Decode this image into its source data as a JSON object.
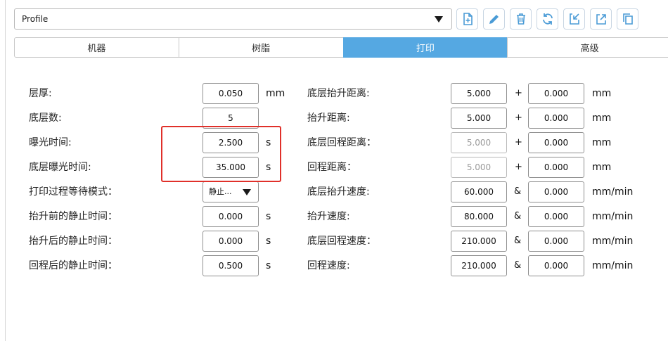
{
  "profile": {
    "value": "Profile"
  },
  "toolbar": {
    "icons": [
      "new-file-icon",
      "pencil-icon",
      "trash-icon",
      "refresh-icon",
      "import-icon",
      "export-icon",
      "copy-icon"
    ]
  },
  "tabs": [
    {
      "label": "机器",
      "active": false
    },
    {
      "label": "树脂",
      "active": false
    },
    {
      "label": "打印",
      "active": true
    },
    {
      "label": "高级",
      "active": false
    }
  ],
  "left": {
    "rows": [
      {
        "label": "层厚:",
        "value": "0.050",
        "unit": "mm"
      },
      {
        "label": "底层数:",
        "value": "5",
        "unit": ""
      },
      {
        "label": "曝光时间:",
        "value": "2.500",
        "unit": "s"
      },
      {
        "label": "底层曝光时间:",
        "value": "35.000",
        "unit": "s"
      },
      {
        "label": "打印过程等待模式：",
        "value": "静止...",
        "unit": ""
      },
      {
        "label": "抬升前的静止时间：",
        "value": "0.000",
        "unit": "s"
      },
      {
        "label": "抬升后的静止时间：",
        "value": "0.000",
        "unit": "s"
      },
      {
        "label": "回程后的静止时间：",
        "value": "0.500",
        "unit": "s"
      }
    ]
  },
  "right": {
    "rows": [
      {
        "label": "底层抬升距离:",
        "value1": "5.000",
        "op": "+",
        "value2": "0.000",
        "unit": "mm"
      },
      {
        "label": "抬升距离:",
        "value1": "5.000",
        "op": "+",
        "value2": "0.000",
        "unit": "mm"
      },
      {
        "label": "底层回程距离：",
        "value1": "5.000",
        "op": "+",
        "value2": "0.000",
        "unit": "mm"
      },
      {
        "label": "回程距离：",
        "value1": "5.000",
        "op": "+",
        "value2": "0.000",
        "unit": "mm"
      },
      {
        "label": "底层抬升速度:",
        "value1": "60.000",
        "op": "&",
        "value2": "0.000",
        "unit": "mm/min"
      },
      {
        "label": "抬升速度:",
        "value1": "80.000",
        "op": "&",
        "value2": "0.000",
        "unit": "mm/min"
      },
      {
        "label": "底层回程速度：",
        "value1": "210.000",
        "op": "&",
        "value2": "0.000",
        "unit": "mm/min"
      },
      {
        "label": "回程速度:",
        "value1": "210.000",
        "op": "&",
        "value2": "0.000",
        "unit": "mm/min"
      }
    ]
  },
  "colors": {
    "accent": "#55a8e2",
    "highlight": "#e0302a",
    "icon": "#4a9bd6"
  }
}
